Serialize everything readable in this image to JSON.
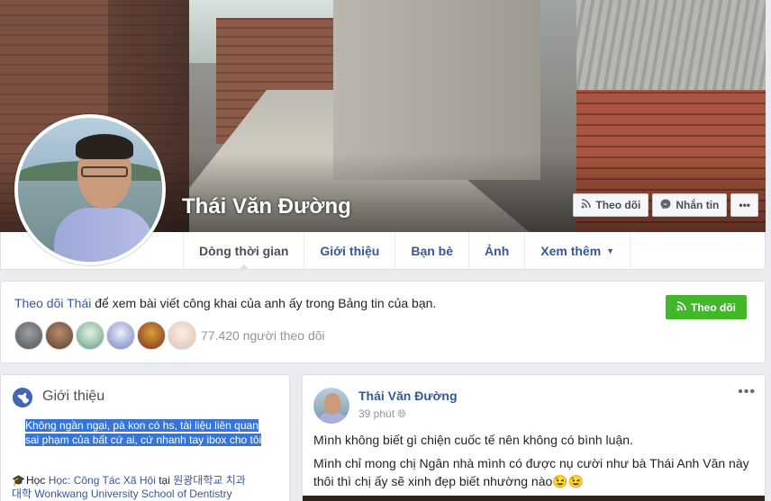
{
  "profile": {
    "name": "Thái Văn Đường"
  },
  "cover_actions": {
    "follow_label": "Theo dõi",
    "message_label": "Nhắn tin",
    "more_label": "•••"
  },
  "tabs": [
    {
      "label": "Dòng thời gian",
      "active": true
    },
    {
      "label": "Giới thiệu"
    },
    {
      "label": "Bạn bè"
    },
    {
      "label": "Ảnh"
    },
    {
      "label": "Xem thêm"
    }
  ],
  "follow_box": {
    "link_text": "Theo dõi Thái",
    "rest_text": " để xem bài viết công khai của anh ấy trong Bảng tin của bạn.",
    "button_label": "Theo dõi",
    "follower_count": "77.420 người theo dõi",
    "avatar_colors": [
      "#6b6f74",
      "#8c6a54",
      "#5c9f7a",
      "#6f7fc2",
      "#7a2c1c",
      "#e8c8b8"
    ]
  },
  "intro": {
    "title": "Giới thiệu",
    "bio_line1": "Không ngần ngại, pà kon có hs, tài liệu liên quan",
    "bio_line2": "sai phạm của bất cứ ai, cứ nhanh tay ibox cho tôi",
    "study_prefix": "Học ",
    "study_link": "Học: Công Tác Xã Hội",
    "study_mid": " tại ",
    "study_school_1": "원광대학교 치과",
    "study_school_2": "대학 Wonkwang University School of Dentistry"
  },
  "post": {
    "author": "Thái Văn Đường",
    "time": "39 phút",
    "more": "•••",
    "line1": "Mình không biết gì chiện cuốc tế nên không có bình luận.",
    "line2": "Mình chỉ mong chị Ngân nhà mình có được nụ cười như bà Thái Anh Văn này",
    "line3": "thôi thì chị ấy sẽ xinh đẹp biết nhường nào😉😉"
  },
  "colors": {
    "link": "#365899",
    "follow_green": "#42b72a",
    "highlight": "#3875d7"
  }
}
